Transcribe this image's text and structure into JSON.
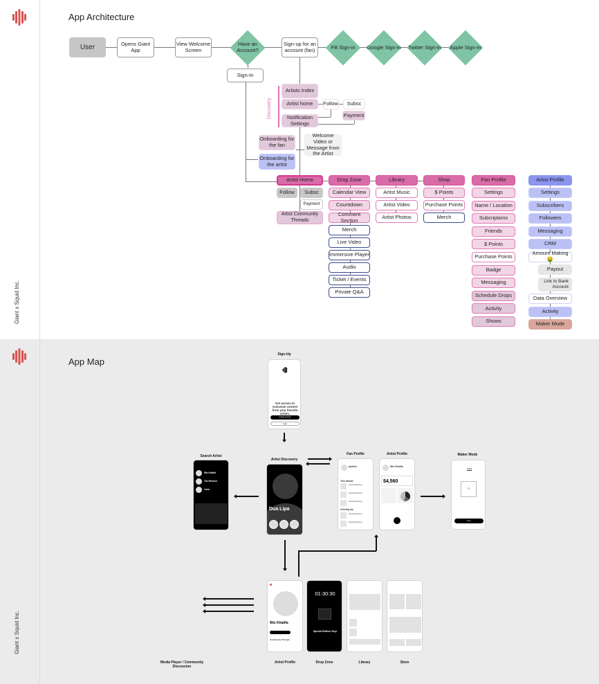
{
  "brand": {
    "accent": "#d9534f",
    "footer_label": "Giant x Squid Inc."
  },
  "architecture": {
    "title": "App Architecture",
    "flow": {
      "user": "User",
      "opens_app": "Opens Giant App",
      "view_welcome": "View Welcome Screen",
      "have_account": "Have an Account?",
      "signup": "Sign-up for an account (fan)",
      "sign_in": "Sign-In",
      "social": [
        "FB Sign-in",
        "Google Sign-in",
        "Twitter Sign-In",
        "Apple Sign-In"
      ]
    },
    "discovery": {
      "label": "Discovery",
      "artists_index": "Artists Index",
      "artist_home": "Artist home",
      "follow": "Follow",
      "subsc": "Subsc",
      "payment": "Payment",
      "notification_settings": "Notification Settings"
    },
    "onboarding": {
      "fan": "Onboarding for the fan",
      "artist": "Onboarding for the artist",
      "welcome_video": "Welcome Video or Message from the Artist"
    },
    "artist_home": {
      "header": "Artist Home",
      "follow": "Follow",
      "subsc": "Subsc",
      "payment": "Payment",
      "threads": "Artist Community Threads"
    },
    "drop_zone": {
      "header": "Drop Zone",
      "highlighted": [
        "Calendar View",
        "Countdown",
        "Comment Section"
      ],
      "items": [
        "Merch",
        "Live Video",
        "Immersive Player",
        "Audio",
        "Ticket / Events",
        "Private Q&A"
      ]
    },
    "library": {
      "header": "Library",
      "items": [
        "Artist Music",
        "Artist Video",
        "Artist Photos"
      ]
    },
    "shop": {
      "header": "Shop",
      "items": [
        "$ Points",
        "Purchase Points",
        "Merch"
      ]
    },
    "fan_profile": {
      "header": "Fan Profile",
      "items": [
        "Settings",
        "Name / Location",
        "Subcriptions",
        "Friends",
        "$ Points",
        "Purchase Points",
        "Badge",
        "Messaging",
        "Schedule Drops",
        "Activity",
        "Shows"
      ]
    },
    "artist_profile": {
      "header": "Artist Profile",
      "items": [
        "Settings",
        "Subscribers",
        "Followers",
        "Messaging",
        "CRM",
        "Amount Making 🤑",
        "Payout",
        "Link to Bank Account",
        "Data Overview",
        "Activity",
        "Maker Mode"
      ]
    }
  },
  "app_map": {
    "title": "App Map",
    "screens": {
      "sign_up": {
        "label": "Sign-Up",
        "headline": "Get access to exclusive content from your favorite artists.",
        "primary": "Create account",
        "secondary": "Login"
      },
      "search_artist": {
        "label": "Search Artist",
        "results": [
          "Wiz Khalifa",
          "The Weeknd",
          "Lizzo"
        ]
      },
      "artist_discovery": {
        "label": "Artist Discovery",
        "artist": "Dua Lipa"
      },
      "fan_profile": {
        "label": "Fan Profile",
        "username": "jmullen",
        "sections": [
          "This Month",
          "Coming Up"
        ],
        "item": "Upcoming Drop"
      },
      "artist_profile": {
        "label": "Artist Profile",
        "artist": "Wiz Khalifa",
        "amount": "$4,560"
      },
      "maker_mode": {
        "label": "Maker Mode",
        "tab_active": "Track",
        "button": "Next"
      },
      "artist_profile_page": {
        "label": "Artist Profile",
        "artist": "Wiz Khalifa",
        "section": "Community Threads"
      },
      "drop_zone": {
        "label": "Drop Zone",
        "countdown": "01:30:30",
        "title": "Special Edition Vinyl"
      },
      "library": {
        "label": "Library"
      },
      "store": {
        "label": "Store"
      },
      "media_player": {
        "label": "Media Player / Community Discussion"
      }
    }
  }
}
